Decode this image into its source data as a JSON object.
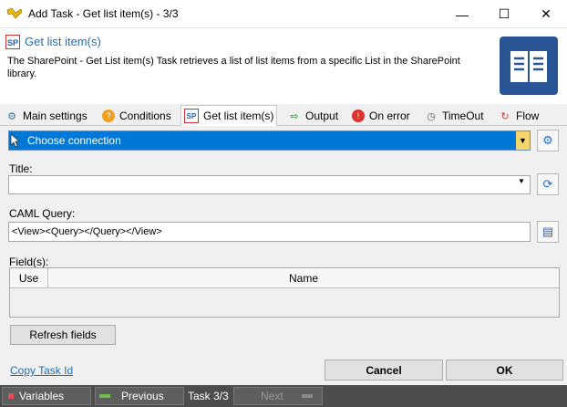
{
  "window": {
    "title": "Add Task - Get list item(s) - 3/3",
    "minimize": "—",
    "maximize": "☐",
    "close": "✕"
  },
  "header": {
    "title": "Get list item(s)",
    "description": "The SharePoint - Get List item(s) Task retrieves a list of list items from a specific List in the SharePoint library.",
    "sp_badge": "SP"
  },
  "tabs": [
    {
      "label": "Main settings"
    },
    {
      "label": "Conditions"
    },
    {
      "label": "Get list item(s)"
    },
    {
      "label": "Output"
    },
    {
      "label": "On error"
    },
    {
      "label": "TimeOut"
    },
    {
      "label": "Flow"
    }
  ],
  "connection": {
    "value": "Choose connection"
  },
  "title_field": {
    "label": "Title:",
    "value": ""
  },
  "caml": {
    "label": "CAML Query:",
    "value": "<View><Query></Query></View>"
  },
  "fields": {
    "label": "Field(s):",
    "columns": [
      "Use",
      "Name"
    ]
  },
  "buttons": {
    "refresh": "Refresh fields",
    "cancel": "Cancel",
    "ok": "OK"
  },
  "footer": {
    "copy_task_id": "Copy Task Id"
  },
  "statusbar": {
    "variables": "Variables",
    "previous": "Previous",
    "task": "Task 3/3",
    "next": "Next"
  }
}
